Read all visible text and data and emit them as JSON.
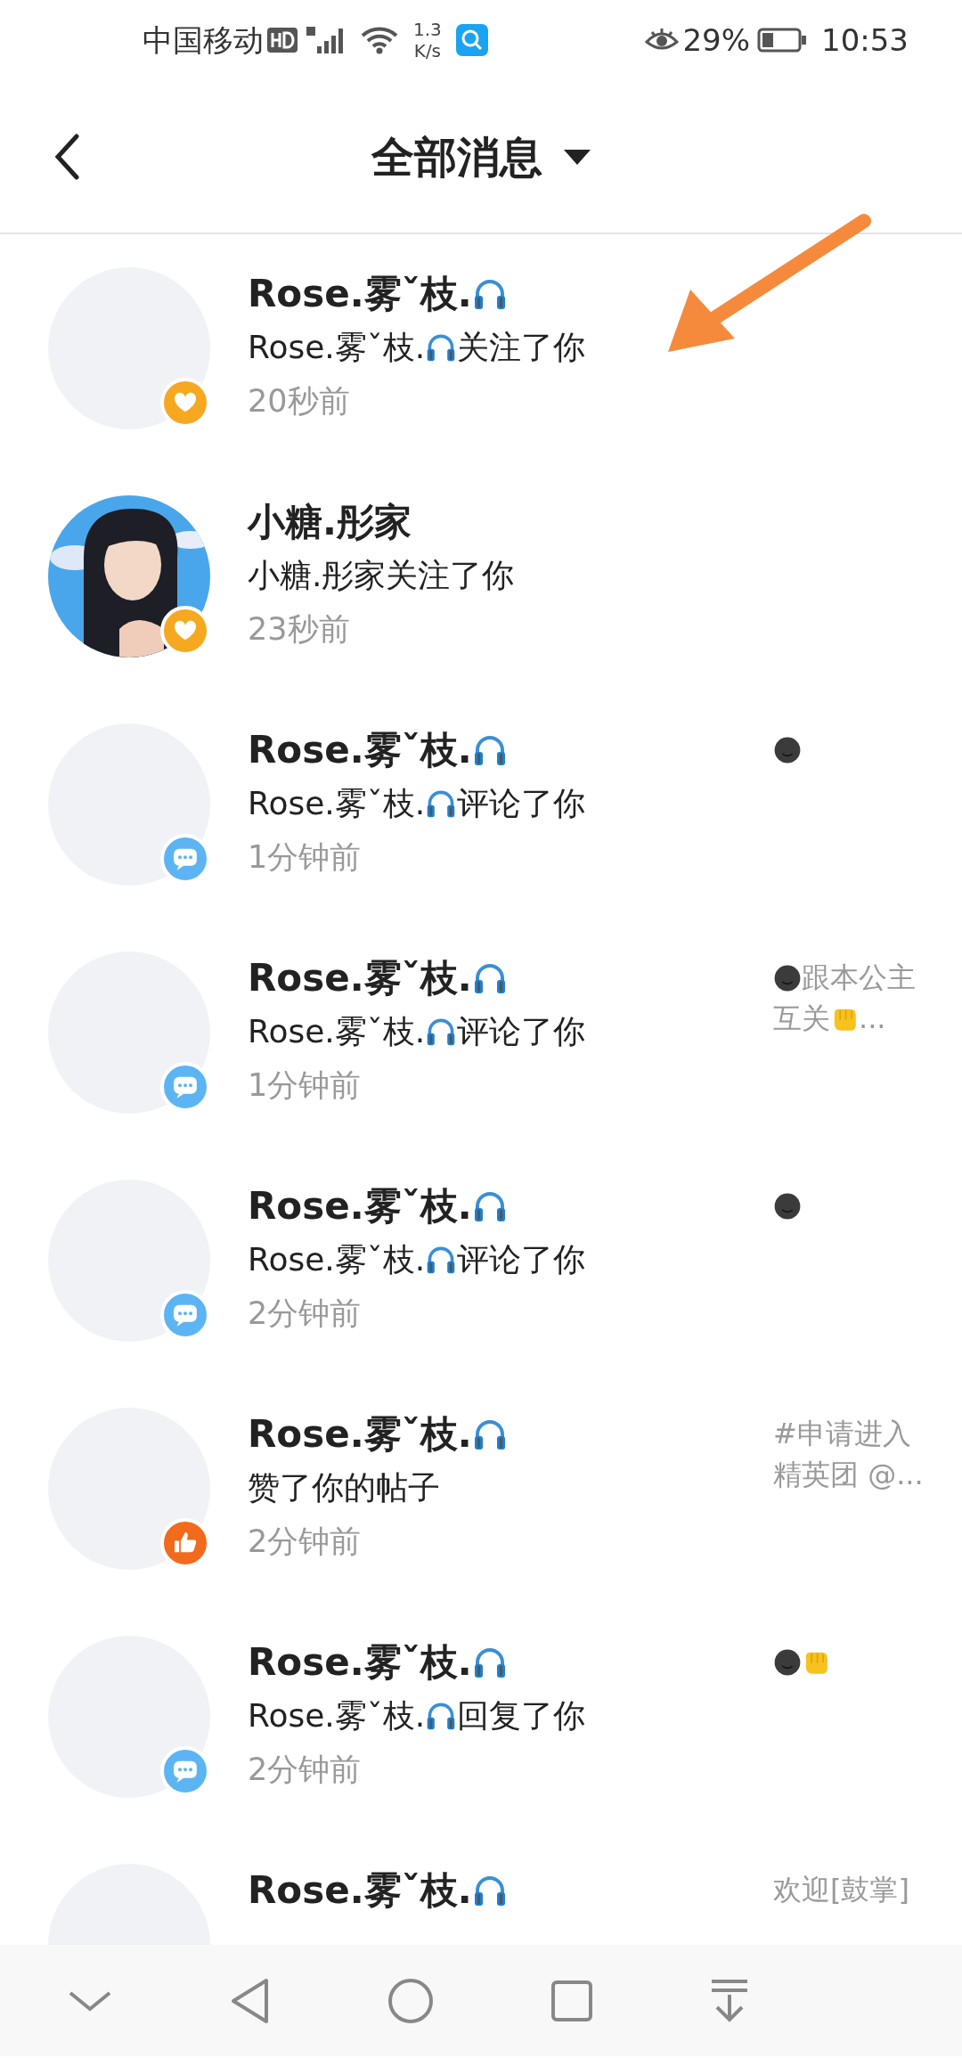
{
  "status_bar": {
    "carrier": "中国移动",
    "speed_value": "1.3",
    "speed_unit": "K/s",
    "battery": "29%",
    "time": "10:53"
  },
  "header": {
    "title": "全部消息"
  },
  "messages": [
    {
      "avatar": {
        "kind": "blank"
      },
      "badge": {
        "kind": "heart"
      },
      "name": [
        {
          "kind": "text",
          "text": "Rose.雾ˇ枝."
        },
        {
          "kind": "headphones"
        }
      ],
      "action": [
        {
          "kind": "text",
          "text": "Rose.雾ˇ枝."
        },
        {
          "kind": "headphones"
        },
        {
          "kind": "text",
          "text": "关注了你"
        }
      ],
      "time": "20秒前"
    },
    {
      "avatar": {
        "kind": "picture"
      },
      "badge": {
        "kind": "heart"
      },
      "name": [
        {
          "kind": "text",
          "text": "小糖.彤家"
        }
      ],
      "action": [
        {
          "kind": "text",
          "text": "小糖.彤家关注了你"
        }
      ],
      "time": "23秒前"
    },
    {
      "avatar": {
        "kind": "blank"
      },
      "badge": {
        "kind": "comment"
      },
      "name": [
        {
          "kind": "text",
          "text": "Rose.雾ˇ枝."
        },
        {
          "kind": "headphones"
        }
      ],
      "action": [
        {
          "kind": "text",
          "text": "Rose.雾ˇ枝."
        },
        {
          "kind": "headphones"
        },
        {
          "kind": "text",
          "text": "评论了你"
        }
      ],
      "time": "1分钟前",
      "preview": [
        {
          "kind": "moon"
        }
      ]
    },
    {
      "avatar": {
        "kind": "blank"
      },
      "badge": {
        "kind": "comment"
      },
      "name": [
        {
          "kind": "text",
          "text": "Rose.雾ˇ枝."
        },
        {
          "kind": "headphones"
        }
      ],
      "action": [
        {
          "kind": "text",
          "text": "Rose.雾ˇ枝."
        },
        {
          "kind": "headphones"
        },
        {
          "kind": "text",
          "text": "评论了你"
        }
      ],
      "time": "1分钟前",
      "preview": [
        {
          "kind": "moon"
        },
        {
          "kind": "text",
          "text": "跟本公主互关"
        },
        {
          "kind": "fist"
        },
        {
          "kind": "text",
          "text": "..."
        }
      ]
    },
    {
      "avatar": {
        "kind": "blank"
      },
      "badge": {
        "kind": "comment"
      },
      "name": [
        {
          "kind": "text",
          "text": "Rose.雾ˇ枝."
        },
        {
          "kind": "headphones"
        }
      ],
      "action": [
        {
          "kind": "text",
          "text": "Rose.雾ˇ枝."
        },
        {
          "kind": "headphones"
        },
        {
          "kind": "text",
          "text": "评论了你"
        }
      ],
      "time": "2分钟前",
      "preview": [
        {
          "kind": "moon"
        }
      ]
    },
    {
      "avatar": {
        "kind": "blank"
      },
      "badge": {
        "kind": "like"
      },
      "name": [
        {
          "kind": "text",
          "text": "Rose.雾ˇ枝."
        },
        {
          "kind": "headphones"
        }
      ],
      "action": [
        {
          "kind": "text",
          "text": "赞了你的帖子"
        }
      ],
      "time": "2分钟前",
      "preview": [
        {
          "kind": "text",
          "text": "#申请进入精英团 @..."
        }
      ]
    },
    {
      "avatar": {
        "kind": "blank"
      },
      "badge": {
        "kind": "comment"
      },
      "name": [
        {
          "kind": "text",
          "text": "Rose.雾ˇ枝."
        },
        {
          "kind": "headphones"
        }
      ],
      "action": [
        {
          "kind": "text",
          "text": "Rose.雾ˇ枝."
        },
        {
          "kind": "headphones"
        },
        {
          "kind": "text",
          "text": "回复了你"
        }
      ],
      "time": "2分钟前",
      "preview": [
        {
          "kind": "moon"
        },
        {
          "kind": "fist"
        }
      ]
    },
    {
      "avatar": {
        "kind": "blank"
      },
      "name": [
        {
          "kind": "text",
          "text": "Rose.雾ˇ枝."
        },
        {
          "kind": "headphones"
        }
      ],
      "preview": [
        {
          "kind": "text",
          "text": "欢迎[鼓掌]"
        }
      ]
    }
  ]
}
